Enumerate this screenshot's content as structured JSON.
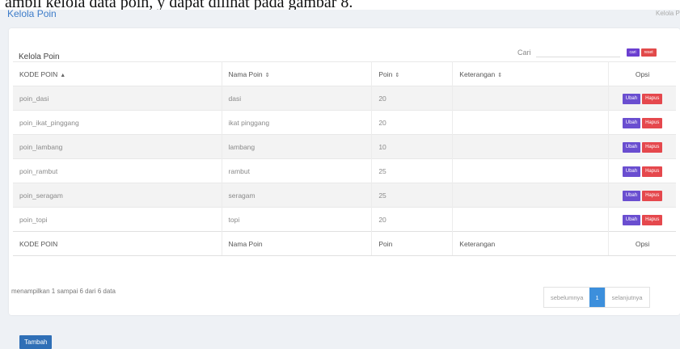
{
  "caption": "ambil kelola data poin, y dapat dilihat pada gambar 8.",
  "header": {
    "title": "Kelola Poin",
    "breadcrumb": "Kelola Poin"
  },
  "card": {
    "title": "Kelola Poin"
  },
  "search": {
    "label": "Cari",
    "value": "",
    "placeholder": "",
    "btn_cari": "cari",
    "btn_reset": "reset"
  },
  "table": {
    "headers": [
      "KODE POIN",
      "Nama Poin",
      "Poin",
      "Keterangan",
      "Opsi"
    ],
    "sort_icons": [
      "▲",
      "⇕",
      "⇕",
      "⇕"
    ],
    "rows": [
      {
        "kode": "poin_dasi",
        "nama": "dasi",
        "poin": "20",
        "ket": ""
      },
      {
        "kode": "poin_ikat_pinggang",
        "nama": "ikat pinggang",
        "poin": "20",
        "ket": ""
      },
      {
        "kode": "poin_lambang",
        "nama": "lambang",
        "poin": "10",
        "ket": ""
      },
      {
        "kode": "poin_rambut",
        "nama": "rambut",
        "poin": "25",
        "ket": ""
      },
      {
        "kode": "poin_seragam",
        "nama": "seragam",
        "poin": "25",
        "ket": ""
      },
      {
        "kode": "poin_topi",
        "nama": "topi",
        "poin": "20",
        "ket": ""
      }
    ],
    "actions": {
      "edit": "Ubah",
      "delete": "Hapus"
    },
    "footer": [
      "KODE POIN",
      "Nama Poin",
      "Poin",
      "Keterangan",
      "Opsi"
    ]
  },
  "info": "menampilkan 1 sampai 6 dari 6 data",
  "pagination": {
    "prev": "sebelumnya",
    "page": "1",
    "next": "selanjutnya"
  },
  "add_button": "Tambah",
  "colors": {
    "accent": "#3d7cc9",
    "edit": "#6a4ed0",
    "delete": "#e5484d",
    "add": "#2f6fb6",
    "page_active": "#3c8fdc"
  }
}
